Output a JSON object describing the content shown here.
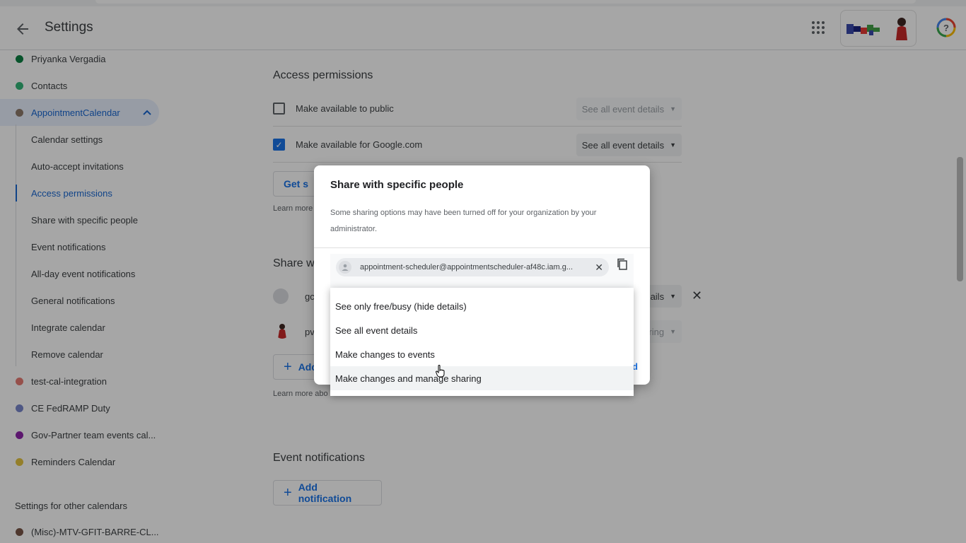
{
  "header": {
    "title": "Settings"
  },
  "sidebar": {
    "calendars": [
      {
        "label": "Priyanka Vergadia",
        "color": "#0b8043"
      },
      {
        "label": "Contacts",
        "color": "#33b679"
      },
      {
        "label": "AppointmentCalendar",
        "color": "#8e7a6b",
        "selected": true
      }
    ],
    "sub_items": [
      {
        "label": "Calendar settings"
      },
      {
        "label": "Auto-accept invitations"
      },
      {
        "label": "Access permissions",
        "active": true
      },
      {
        "label": "Share with specific people"
      },
      {
        "label": "Event notifications"
      },
      {
        "label": "All-day event notifications"
      },
      {
        "label": "General notifications"
      },
      {
        "label": "Integrate calendar"
      },
      {
        "label": "Remove calendar"
      }
    ],
    "more_calendars": [
      {
        "label": "test-cal-integration",
        "color": "#e67c73"
      },
      {
        "label": "CE FedRAMP Duty",
        "color": "#7986cb"
      },
      {
        "label": "Gov-Partner team events cal...",
        "color": "#8e24aa"
      },
      {
        "label": "Reminders Calendar",
        "color": "#e4c441"
      }
    ],
    "other_section_label": "Settings for other calendars",
    "other_calendars": [
      {
        "label": "(Misc)-MTV-GFIT-BARRE-CL...",
        "color": "#795548"
      }
    ]
  },
  "main": {
    "access_title": "Access permissions",
    "public_row": {
      "label": "Make available to public",
      "checked": false,
      "select": "See all event details"
    },
    "google_row": {
      "label": "Make available for Google.com",
      "checked": true,
      "select": "See all event details"
    },
    "get_link_btn": "Get s",
    "learn_more_1": "Learn more",
    "share_title_partial": "Share w",
    "person1_partial": "gc",
    "person1_select_partial": "ails",
    "person2_partial": "pv",
    "person2_select_partial": "ring",
    "add_people_partial": "Add",
    "learn_more_2": "Learn more abo",
    "event_notif_title": "Event notifications",
    "add_notification": "Add notification"
  },
  "dialog": {
    "title": "Share with specific people",
    "subtitle": "Some sharing options may have been turned off for your organization by your administrator.",
    "chip_email": "appointment-scheduler@appointmentscheduler-af48c.iam.g...",
    "send_partial": "d"
  },
  "menu": {
    "items": [
      {
        "label": "See only free/busy (hide details)"
      },
      {
        "label": "See all event details"
      },
      {
        "label": "Make changes to events"
      },
      {
        "label": "Make changes and manage sharing",
        "hover": true
      }
    ]
  },
  "colors": {
    "accent": "#1a73e8",
    "selected_bg": "#e8f0fe"
  }
}
